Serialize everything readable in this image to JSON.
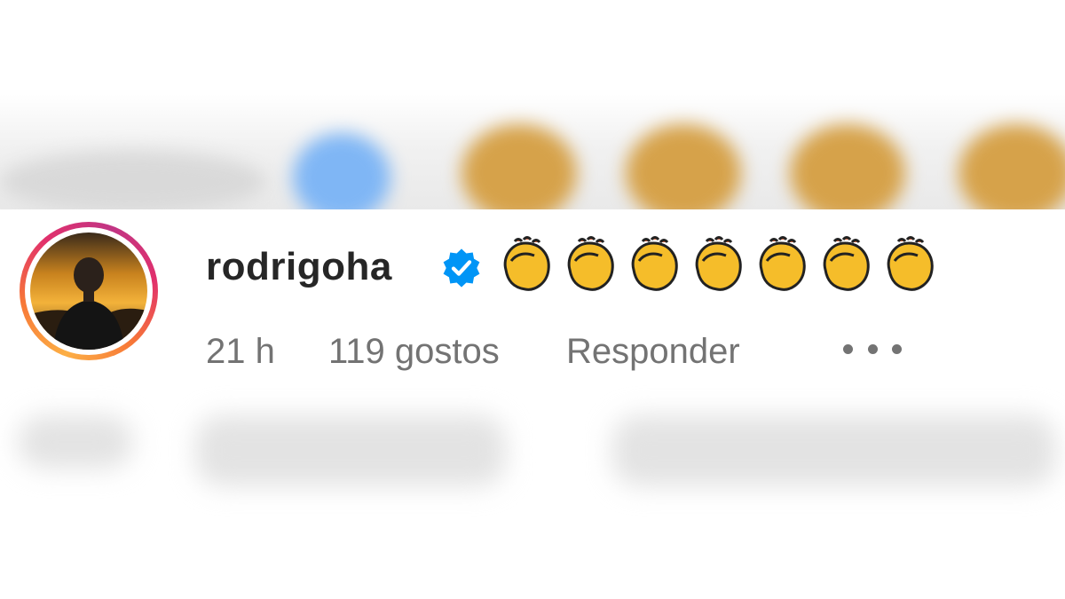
{
  "comment": {
    "username": "rodrigoha",
    "verified_icon": "verified-badge-icon",
    "emoji": [
      "clapping-hands",
      "clapping-hands",
      "clapping-hands",
      "clapping-hands",
      "clapping-hands",
      "clapping-hands",
      "clapping-hands"
    ],
    "time": "21 h",
    "likes": "119 gostos",
    "reply_label": "Responder",
    "more_icon": "more-options-icon"
  },
  "colors": {
    "text_primary": "#262626",
    "text_secondary": "#737373",
    "verified_blue": "#0095f6",
    "emoji_yellow": "#f5bd2a"
  }
}
